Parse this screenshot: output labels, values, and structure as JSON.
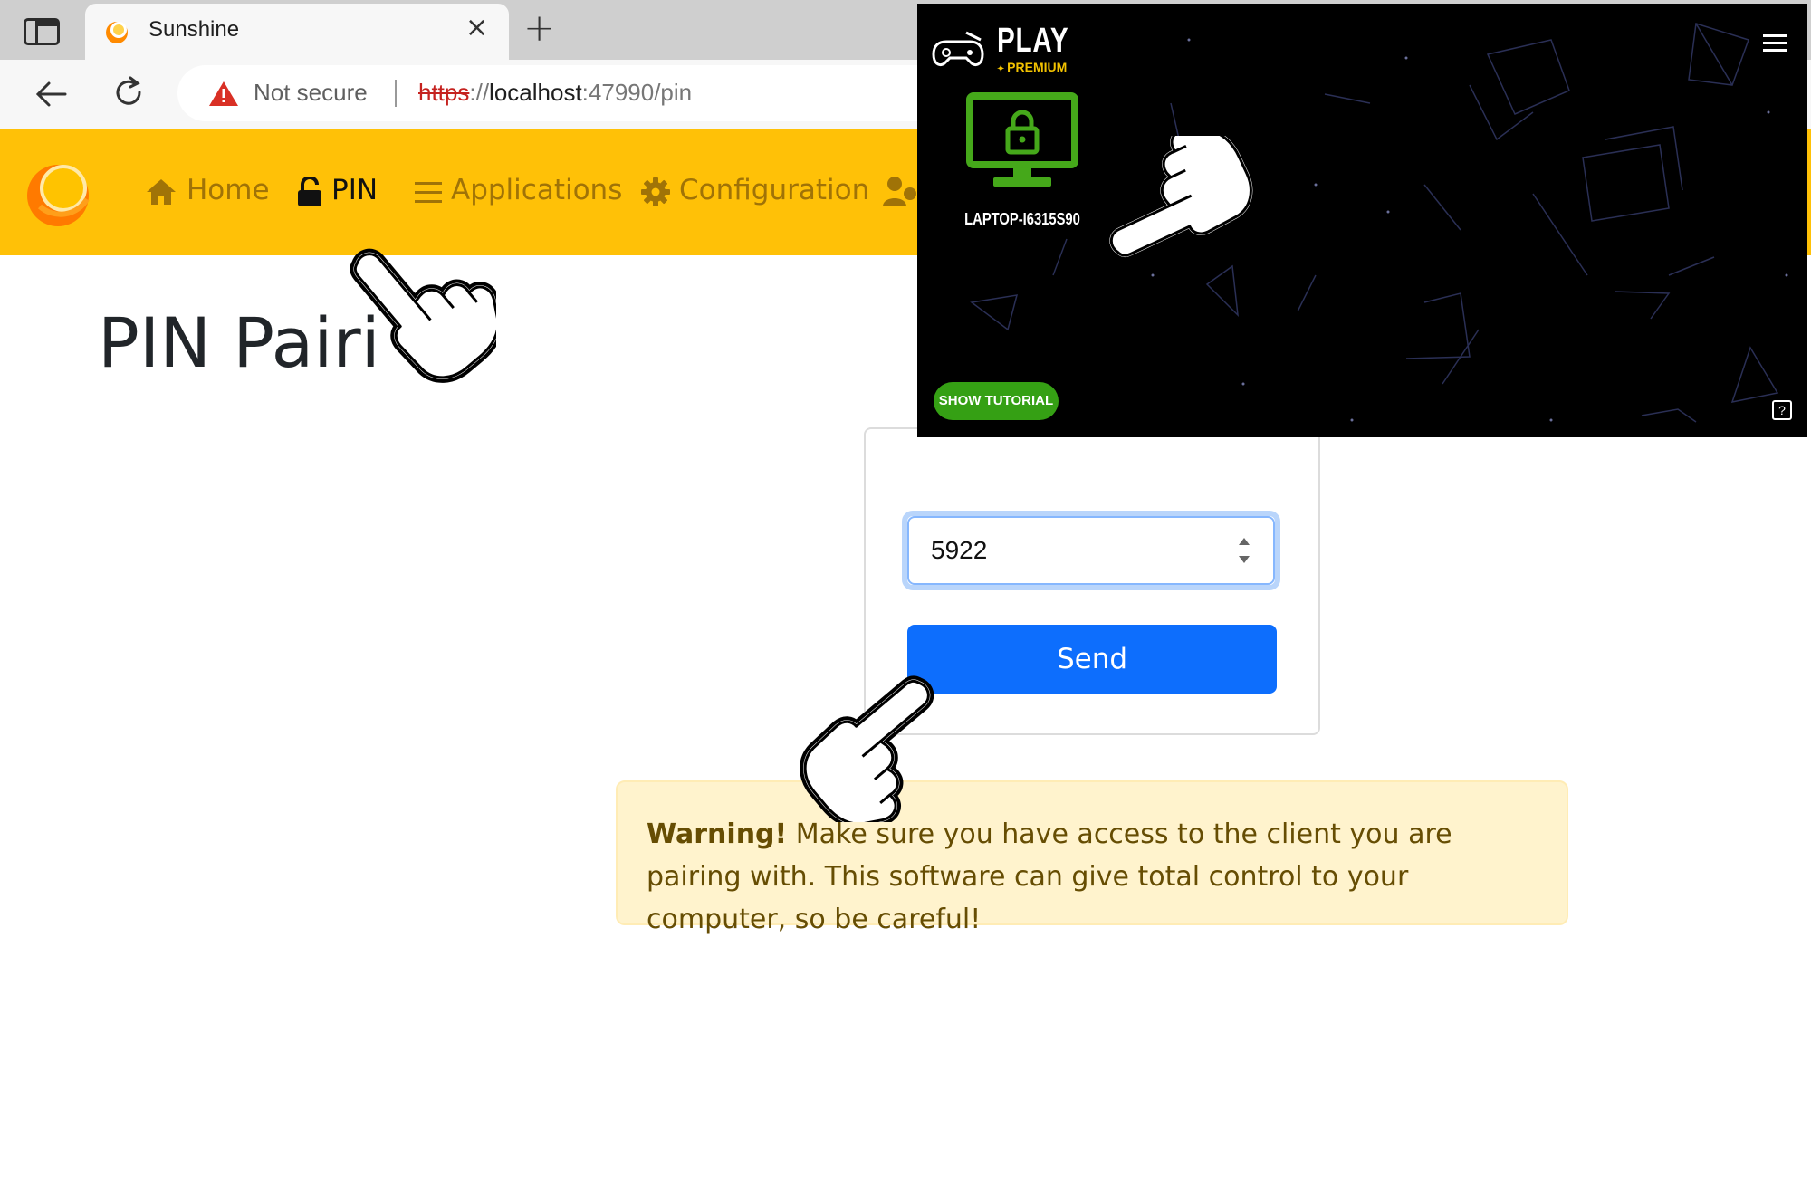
{
  "browser": {
    "tab_title": "Sunshine",
    "close_glyph": "×",
    "new_tab_glyph": "+",
    "security_label": "Not secure",
    "url_scheme": "https",
    "url_separator": "://",
    "url_host": "localhost",
    "url_rest": ":47990/pin"
  },
  "site_nav": {
    "items": [
      {
        "label": "Home",
        "icon": "home-icon",
        "active": false
      },
      {
        "label": "PIN",
        "icon": "unlock-icon",
        "active": true
      },
      {
        "label": "Applications",
        "icon": "list-icon",
        "active": false
      },
      {
        "label": "Configuration",
        "icon": "gear-icon",
        "active": false
      }
    ]
  },
  "page": {
    "title": "PIN Pairi",
    "pin_value": "5922",
    "send_label": "Send",
    "warning_strong": "Warning!",
    "warning_text": " Make sure you have access to the client you are pairing with. This software can give total control to your computer, so be careful!"
  },
  "overlay": {
    "brand": "PLAY",
    "tier": "PREMIUM",
    "host_name": "LAPTOP-I6315S90",
    "tutorial_label": "SHOW TUTORIAL",
    "help_glyph": "?"
  },
  "colors": {
    "nav_yellow": "#ffc107",
    "primary_blue": "#0d6efd",
    "warning_bg": "#fff3cd",
    "host_green": "#45a81a"
  }
}
